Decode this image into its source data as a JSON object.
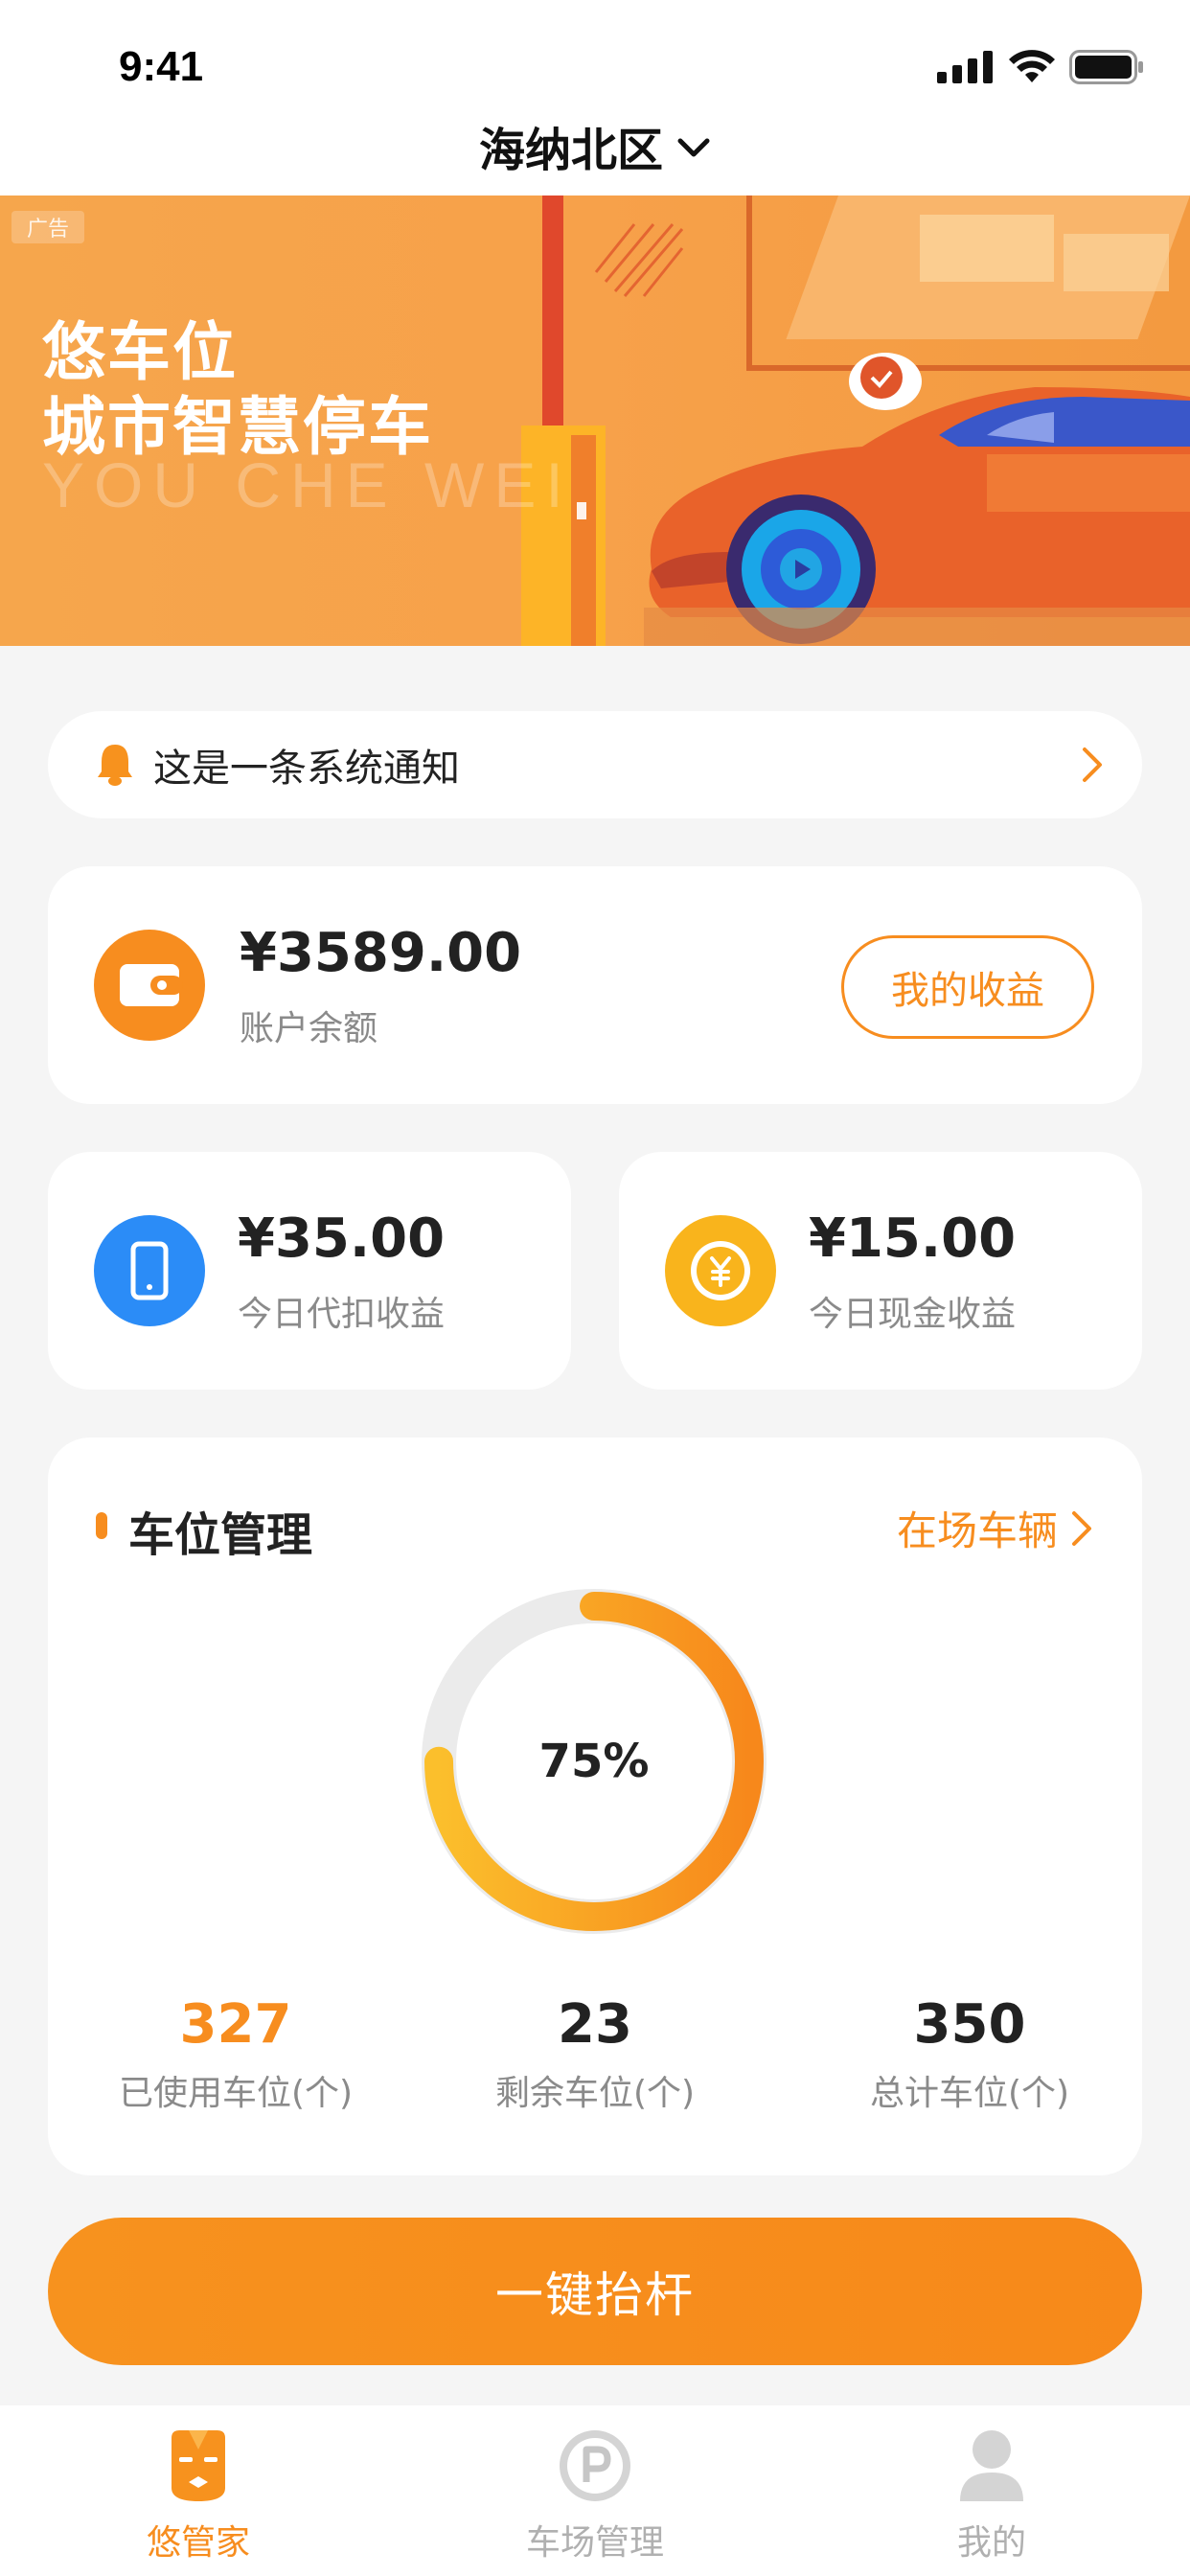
{
  "status_bar": {
    "time": "9:41"
  },
  "header": {
    "title": "海纳北区",
    "dropdown_icon": "chevron-down-icon"
  },
  "banner": {
    "ad_tag": "广告",
    "title_line1": "悠车位",
    "title_line2": "城市智慧停车",
    "subtitle_en": "YOU CHE WEI"
  },
  "notice": {
    "icon": "bell-icon",
    "text": "这是一条系统通知",
    "arrow_icon": "chevron-right-icon"
  },
  "balance": {
    "icon": "wallet-icon",
    "amount": "¥3589.00",
    "label": "账户余额",
    "button": "我的收益",
    "accent": "#f78d1f"
  },
  "income_cards": [
    {
      "icon": "phone-icon",
      "icon_color": "#2b8cf7",
      "amount": "¥35.00",
      "label": "今日代扣收益"
    },
    {
      "icon": "yen-coin-icon",
      "icon_color": "#f9b41c",
      "amount": "¥15.00",
      "label": "今日现金收益"
    }
  ],
  "parking": {
    "title": "车位管理",
    "link": "在场车辆",
    "usage_percent_label": "75%",
    "usage_fraction": 0.75,
    "stats": [
      {
        "value": "327",
        "label": "已使用车位(个)",
        "color": "#f78d1f"
      },
      {
        "value": "23",
        "label": "剩余车位(个)",
        "color": "#222222"
      },
      {
        "value": "350",
        "label": "总计车位(个)",
        "color": "#222222"
      }
    ]
  },
  "action_button": "一键抬杆",
  "tabs": [
    {
      "label": "悠管家",
      "icon": "butler-icon",
      "active": true
    },
    {
      "label": "车场管理",
      "icon": "parking-p-icon",
      "active": false
    },
    {
      "label": "我的",
      "icon": "user-icon",
      "active": false
    }
  ]
}
